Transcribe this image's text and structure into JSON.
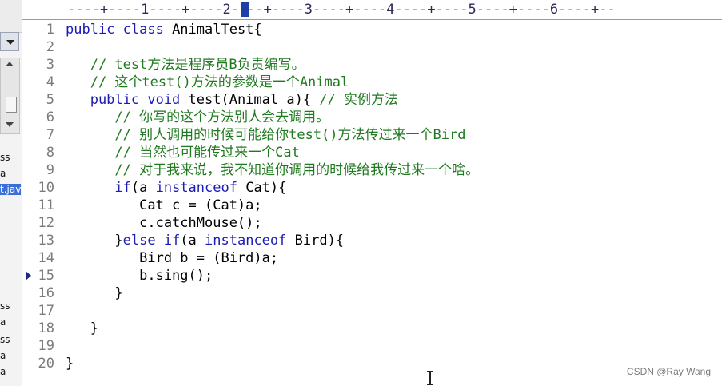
{
  "ruler": {
    "text": "----+----1----+----2----+----3----+----4----+----5----+----6----+--"
  },
  "left_pane": {
    "tree_fragments": [
      "ss",
      "a",
      "t.jav",
      "ss",
      "a",
      "ss",
      "a",
      "a"
    ],
    "selected_index": 2
  },
  "editor": {
    "bookmark_line": 15,
    "lines": [
      {
        "n": "1",
        "segs": [
          {
            "t": "public class ",
            "c": "kw"
          },
          {
            "t": "AnimalTest{",
            "c": ""
          }
        ]
      },
      {
        "n": "2",
        "segs": []
      },
      {
        "n": "3",
        "segs": [
          {
            "t": "   // test方法是程序员B负责编写。",
            "c": "cm"
          }
        ]
      },
      {
        "n": "4",
        "segs": [
          {
            "t": "   // 这个test()方法的参数是一个Animal",
            "c": "cm"
          }
        ]
      },
      {
        "n": "5",
        "segs": [
          {
            "t": "   public void ",
            "c": "kw"
          },
          {
            "t": "test(Animal a){ ",
            "c": ""
          },
          {
            "t": "// 实例方法",
            "c": "cm"
          }
        ]
      },
      {
        "n": "6",
        "segs": [
          {
            "t": "      // 你写的这个方法别人会去调用。",
            "c": "cm"
          }
        ]
      },
      {
        "n": "7",
        "segs": [
          {
            "t": "      // 别人调用的时候可能给你test()方法传过来一个Bird",
            "c": "cm"
          }
        ]
      },
      {
        "n": "8",
        "segs": [
          {
            "t": "      // 当然也可能传过来一个Cat",
            "c": "cm"
          }
        ]
      },
      {
        "n": "9",
        "segs": [
          {
            "t": "      // 对于我来说，我不知道你调用的时候给我传过来一个啥。",
            "c": "cm"
          }
        ]
      },
      {
        "n": "10",
        "segs": [
          {
            "t": "      if",
            "c": "kw"
          },
          {
            "t": "(a ",
            "c": ""
          },
          {
            "t": "instanceof ",
            "c": "kw"
          },
          {
            "t": "Cat){",
            "c": ""
          }
        ]
      },
      {
        "n": "11",
        "segs": [
          {
            "t": "         Cat c = (Cat)a;",
            "c": ""
          }
        ]
      },
      {
        "n": "12",
        "segs": [
          {
            "t": "         c.catchMouse();",
            "c": ""
          }
        ]
      },
      {
        "n": "13",
        "segs": [
          {
            "t": "      }",
            "c": ""
          },
          {
            "t": "else if",
            "c": "kw"
          },
          {
            "t": "(a ",
            "c": ""
          },
          {
            "t": "instanceof ",
            "c": "kw"
          },
          {
            "t": "Bird){",
            "c": ""
          }
        ]
      },
      {
        "n": "14",
        "segs": [
          {
            "t": "         Bird b = (Bird)a;",
            "c": ""
          }
        ]
      },
      {
        "n": "15",
        "segs": [
          {
            "t": "         b.sing();",
            "c": ""
          }
        ]
      },
      {
        "n": "16",
        "segs": [
          {
            "t": "      }",
            "c": ""
          }
        ]
      },
      {
        "n": "17",
        "segs": []
      },
      {
        "n": "18",
        "segs": [
          {
            "t": "   }",
            "c": ""
          }
        ]
      },
      {
        "n": "19",
        "segs": []
      },
      {
        "n": "20",
        "segs": [
          {
            "t": "}",
            "c": ""
          }
        ]
      }
    ]
  },
  "watermark": "CSDN @Ray Wang",
  "colors": {
    "keyword": "#1b1bb8",
    "comment": "#1f7a1f",
    "line_number": "#7b7b7b"
  }
}
